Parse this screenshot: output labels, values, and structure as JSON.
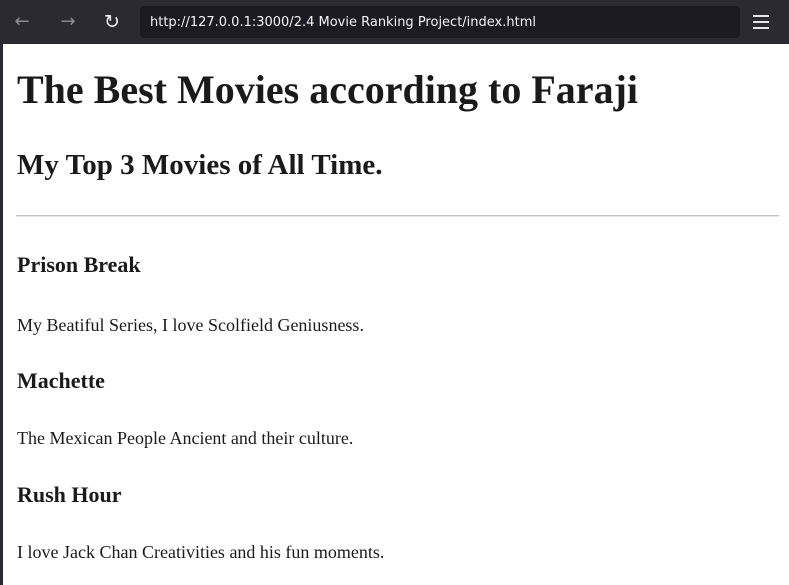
{
  "browser": {
    "back_icon": "arrow-left-icon",
    "forward_icon": "arrow-right-icon",
    "reload_icon": "reload-icon",
    "menu_icon": "hamburger-menu-icon",
    "url": "http://127.0.0.1:3000/2.4 Movie Ranking Project/index.html"
  },
  "page": {
    "title": "The Best Movies according to Faraji",
    "subtitle": "My Top 3 Movies of All Time.",
    "movies": [
      {
        "title": "Prison Break",
        "description": "My Beatiful Series, I love Scolfield Geniusness."
      },
      {
        "title": "Machette",
        "description": "The Mexican People Ancient and their culture."
      },
      {
        "title": "Rush Hour",
        "description": "I love Jack Chan Creativities and his fun moments."
      }
    ]
  }
}
